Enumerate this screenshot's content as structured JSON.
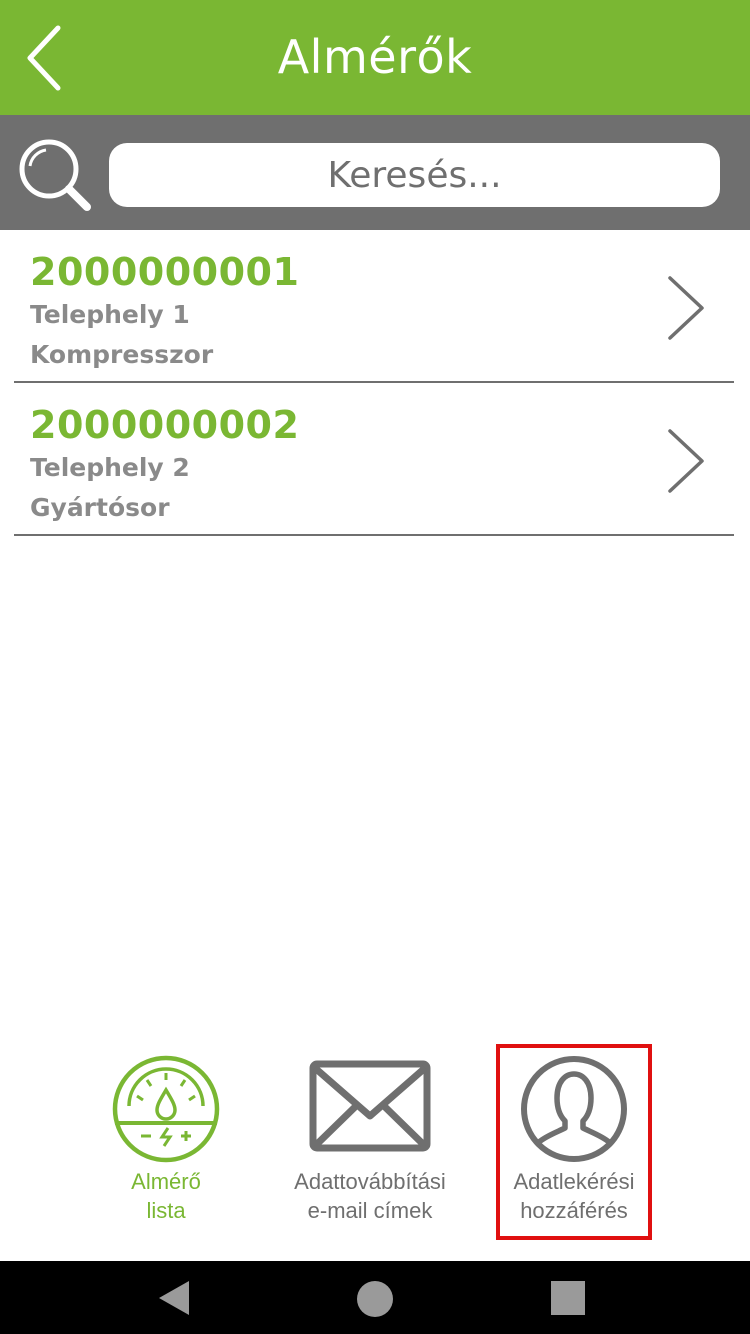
{
  "header": {
    "title": "Almérők",
    "back_icon": "chevron-left-icon"
  },
  "search": {
    "placeholder": "Keresés...",
    "icon": "search-icon"
  },
  "meters": [
    {
      "id": "2000000001",
      "site": "Telephely 1",
      "device": "Kompresszor"
    },
    {
      "id": "2000000002",
      "site": "Telephely 2",
      "device": "Gyártósor"
    }
  ],
  "tabs": [
    {
      "label_line1": "Almérő",
      "label_line2": "lista",
      "icon": "meter-gauge-icon",
      "active": true
    },
    {
      "label_line1": "Adattovábbítási",
      "label_line2": "e-mail címek",
      "icon": "envelope-icon",
      "active": false
    },
    {
      "label_line1": "Adatlekérési",
      "label_line2": "hozzáférés",
      "icon": "user-icon",
      "active": false
    }
  ],
  "colors": {
    "accent": "#7ab733",
    "gray": "#6f6f6f",
    "highlight": "#e01010"
  },
  "system_nav": [
    "back-icon",
    "home-icon",
    "recents-icon"
  ]
}
